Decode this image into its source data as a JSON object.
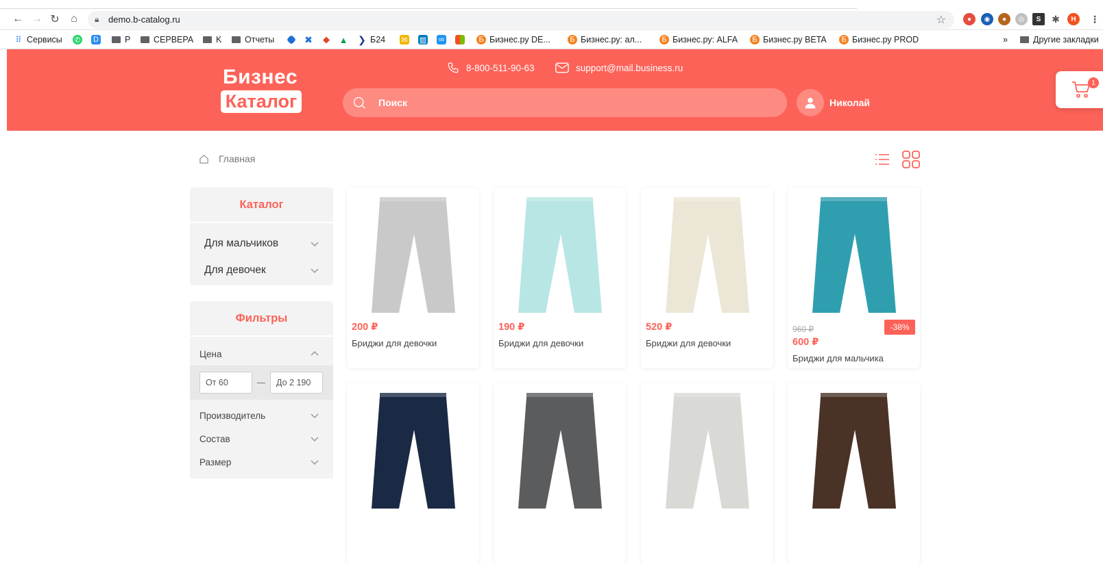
{
  "browser": {
    "url": "demo.b-catalog.ru",
    "profile_initial": "Н"
  },
  "bookmarks": [
    {
      "label": "Сервисы",
      "icon": "apps-grid-icon"
    },
    {
      "label": "",
      "icon": "whatsapp-icon"
    },
    {
      "label": "",
      "icon": "d-logo-icon"
    },
    {
      "label": "P",
      "icon": "folder-icon"
    },
    {
      "label": "СЕРВЕРА",
      "icon": "folder-icon"
    },
    {
      "label": "K",
      "icon": "folder-icon"
    },
    {
      "label": "Отчеты",
      "icon": "folder-icon"
    },
    {
      "label": "Б24",
      "icon": "chevron-icon"
    },
    {
      "label": "Бизнес.ру DE...",
      "icon": "b-logo-icon"
    },
    {
      "label": "Бизнес.ру: ал...",
      "icon": "b-logo-icon"
    },
    {
      "label": "Бизнес.ру: ALFA",
      "icon": "b-logo-icon"
    },
    {
      "label": "Бизнес.ру BETA",
      "icon": "b-logo-icon"
    },
    {
      "label": "Бизнес.ру PROD",
      "icon": "b-logo-icon"
    },
    {
      "label": "»",
      "icon": ""
    },
    {
      "label": "Другие закладки",
      "icon": "folder-icon"
    }
  ],
  "header": {
    "logo_top": "Бизнес",
    "logo_bottom": "Каталог",
    "phone": "8-800-511-90-63",
    "email": "support@mail.business.ru",
    "search_placeholder": "Поиск",
    "user_name": "Николай",
    "cart_count": "1"
  },
  "breadcrumb": {
    "home": "Главная"
  },
  "catalog": {
    "title": "Каталог",
    "items": [
      "Для мальчиков",
      "Для девочек"
    ]
  },
  "filters": {
    "title": "Фильтры",
    "price_label": "Цена",
    "price_from": "От 60",
    "price_to": "До 2 190",
    "items": [
      "Производитель",
      "Состав",
      "Размер"
    ]
  },
  "products": [
    {
      "price": "200 ₽",
      "old_price": "",
      "discount": "",
      "title": "Бриджи для девочки",
      "color": "#c9c9c9"
    },
    {
      "price": "190 ₽",
      "old_price": "",
      "discount": "",
      "title": "Бриджи для девочки",
      "color": "#b8e6e4"
    },
    {
      "price": "520 ₽",
      "old_price": "",
      "discount": "",
      "title": "Бриджи для девочки",
      "color": "#ece6d6"
    },
    {
      "price": "600 ₽",
      "old_price": "960 ₽",
      "discount": "-38%",
      "title": "Бриджи для мальчика",
      "color": "#2f9fb0"
    },
    {
      "price": "",
      "old_price": "",
      "discount": "",
      "title": "",
      "color": "#1b2a44"
    },
    {
      "price": "",
      "old_price": "",
      "discount": "",
      "title": "",
      "color": "#5a5c5e"
    },
    {
      "price": "",
      "old_price": "",
      "discount": "",
      "title": "",
      "color": "#d9d9d6"
    },
    {
      "price": "",
      "old_price": "",
      "discount": "",
      "title": "",
      "color": "#4a3226"
    }
  ]
}
